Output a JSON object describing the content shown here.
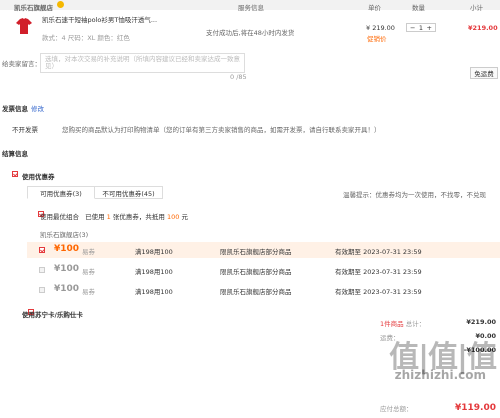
{
  "header": {
    "shop_name": "凯乐石旗舰店",
    "col_service": "服务信息",
    "col_unit_price": "单价",
    "col_qty": "数量",
    "col_subtotal": "小计"
  },
  "product": {
    "title": "凯乐石速干短袖polo衫男T恤吸汗透气...",
    "attrs": "款式：4  尺码：XL  颜色：红色",
    "service_text": "支付成功后,将在48小时内发货",
    "unit_price": "¥ 219.00",
    "promo": "促销价",
    "qty": "1",
    "subtotal": "¥219.00",
    "thumb_color": "#d11f2a"
  },
  "remark": {
    "label": "给卖家留言：",
    "placeholder": "选填，对本次交易的补充说明（所填内容建议已经和卖家达成一致意见）",
    "count": "0 /85",
    "ship_button": "免运费"
  },
  "invoice": {
    "title": "发票信息",
    "edit": "修改",
    "type": "不开发票",
    "note": "您购买的商品默认为打印购物清单（您的订单有第三方卖家销售的商品，如需开发票，请自行联系卖家开具！）"
  },
  "settle": {
    "title": "结算信息",
    "use_coupon": "使用优惠券",
    "tabs": [
      "可用优惠券(3)",
      "不可用优惠券(45)"
    ],
    "tip": "温馨提示：优惠券均为一次使用，不找零，不兑现",
    "best_combo": "使用最优组合",
    "best_combo_desc_1": "已使用",
    "best_combo_count": "1",
    "best_combo_desc_2": "张优惠券，共抵用",
    "best_combo_amount": "100",
    "best_combo_unit": "元",
    "shop_group": "凯乐石旗舰店(3)",
    "coupons": [
      {
        "amount": "¥100",
        "type": "易券",
        "cond": "满198用100",
        "scope": "限凯乐石旗舰店部分商品",
        "expire": "有效期至 2023-07-31 23:59",
        "checked": true
      },
      {
        "amount": "¥100",
        "type": "易券",
        "cond": "满198用100",
        "scope": "限凯乐石旗舰店部分商品",
        "expire": "有效期至 2023-07-31 23:59",
        "checked": false
      },
      {
        "amount": "¥100",
        "type": "易券",
        "cond": "满198用100",
        "scope": "限凯乐石旗舰店部分商品",
        "expire": "有效期至 2023-07-31 23:59",
        "checked": false
      }
    ],
    "suning_card": "使用苏宁卡/乐购仕卡"
  },
  "summary": {
    "items_label": "1件商品",
    "total_label": "总计：",
    "total_value": "¥219.00",
    "freight_label": "运费：",
    "freight_value": "¥0.00",
    "discount_value": "-¥100.00",
    "final_label": "应付总额：",
    "final_value": "¥119.00"
  },
  "watermark": {
    "text": "值|值|值",
    "url": "zhizhizhi.com"
  },
  "colors": {
    "accent": "#ff6600",
    "price_red": "#e4393c",
    "link": "#3366cc"
  }
}
